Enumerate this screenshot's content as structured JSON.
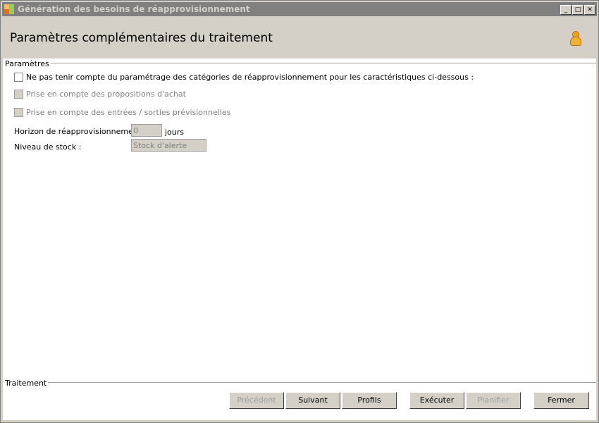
{
  "window": {
    "title": "Génération des besoins de réapprovisionnement",
    "controls": {
      "minimize": "_",
      "maximize": "□",
      "close": "✕"
    }
  },
  "header": {
    "title": "Paramètres complémentaires du traitement"
  },
  "parametres": {
    "group_label": "Paramètres",
    "ignore_categories": {
      "label": "Ne pas tenir compte du paramétrage des catégories de réapprovisionnement pour les caractéristiques ci-dessous :",
      "checked": false
    },
    "achat": {
      "label": "Prise en compte des propositions d'achat",
      "checked": false,
      "enabled": false
    },
    "entrees_sorties": {
      "label": "Prise en compte des entrées / sorties prévisionnelles",
      "checked": false,
      "enabled": false
    },
    "horizon": {
      "label": "Horizon de réapprovisionnement :",
      "value": "0",
      "unit": "jours"
    },
    "niveau_stock": {
      "label": "Niveau de stock :",
      "value": "Stock d'alerte"
    }
  },
  "traitement": {
    "group_label": "Traitement",
    "buttons": {
      "precedent": "Précédent",
      "suivant": "Suivant",
      "profils": "Profils",
      "executer": "Exécuter",
      "planifier": "Planifier",
      "fermer": "Fermer"
    }
  }
}
